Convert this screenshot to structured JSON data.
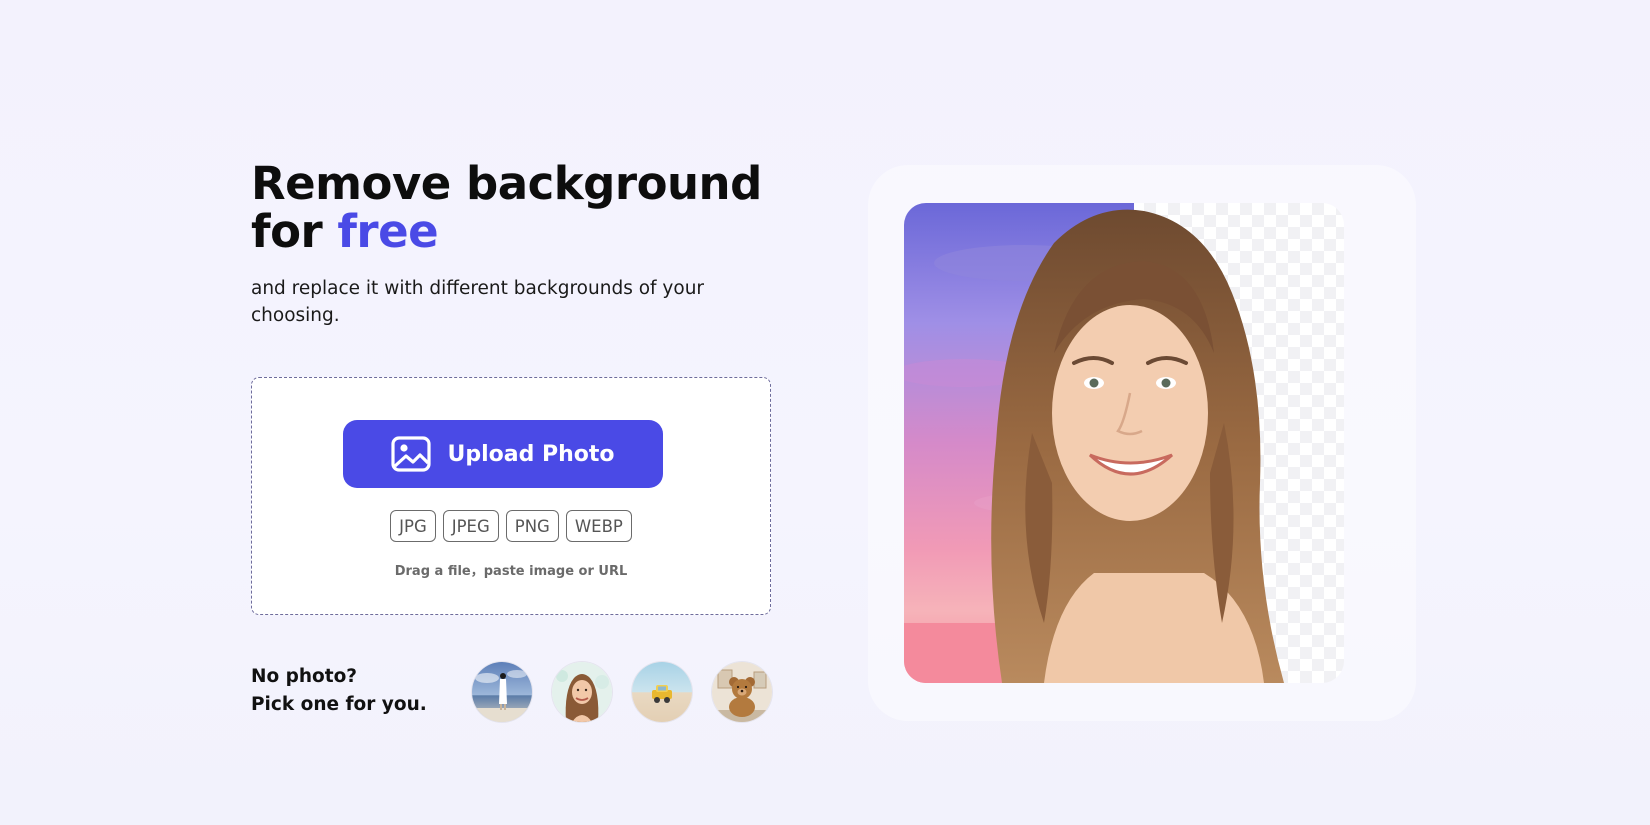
{
  "hero": {
    "title_line1": "Remove background",
    "title_for": "for ",
    "title_accent": "free",
    "subtitle": "and replace it with different backgrounds of your choosing."
  },
  "upload": {
    "button_label": "Upload Photo",
    "button_icon": "image-icon",
    "formats": [
      "JPG",
      "JPEG",
      "PNG",
      "WEBP"
    ],
    "hint": "Drag a file，paste image or URL"
  },
  "samples": {
    "prompt_line1": "No photo?",
    "prompt_line2": "Pick one for you.",
    "items": [
      "sample-woman-beach",
      "sample-portrait",
      "sample-toy-car",
      "sample-teddy-bear"
    ]
  },
  "colors": {
    "accent": "#4a4ae6",
    "background": "#f4f3fe",
    "dropzone_border": "#6e6c9c"
  }
}
